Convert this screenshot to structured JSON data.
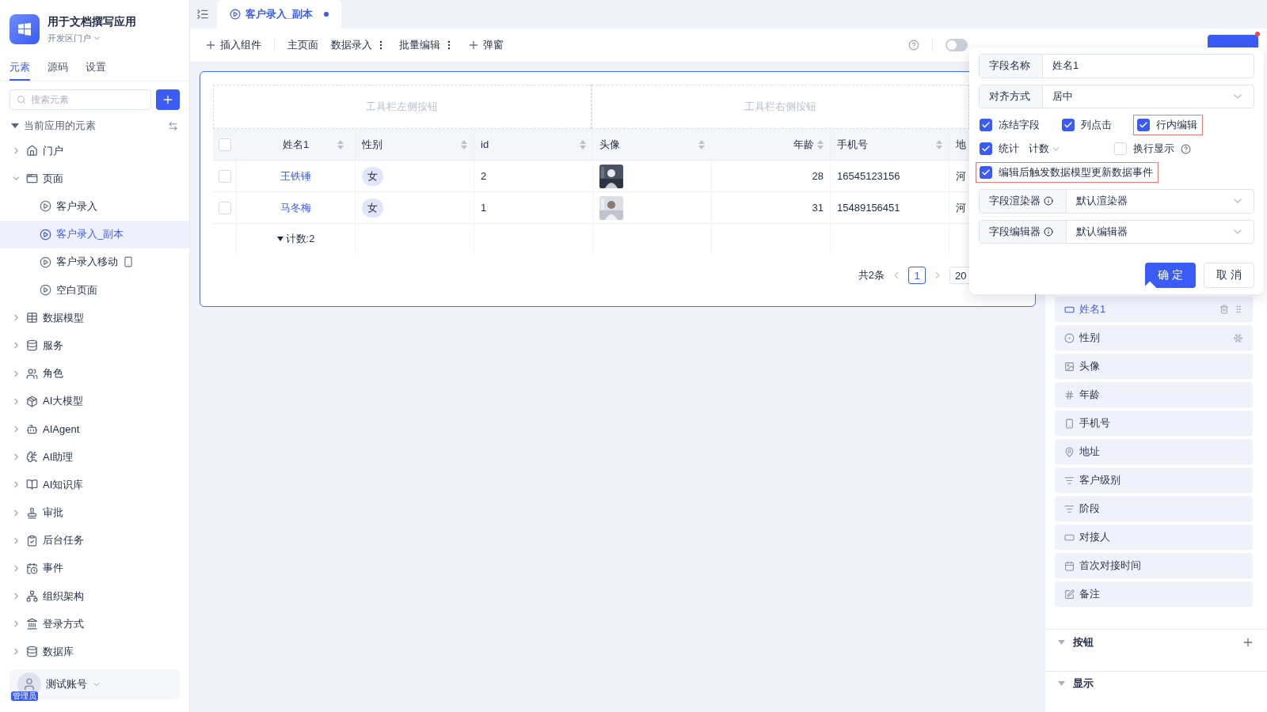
{
  "app": {
    "name": "用于文档撰写应用",
    "portal": "开发区门户"
  },
  "sidebar_tabs": [
    {
      "label": "元素",
      "selected": true
    },
    {
      "label": "源码",
      "selected": false
    },
    {
      "label": "设置",
      "selected": false
    }
  ],
  "search": {
    "placeholder": "搜索元素"
  },
  "tree_header": {
    "label": "当前应用的元素",
    "expanded": true
  },
  "tree": [
    {
      "label": "门户",
      "expanded": false,
      "selected": false
    },
    {
      "label": "页面",
      "expanded": true,
      "selected": false,
      "children": [
        {
          "label": "客户录入",
          "selected": false,
          "mobile": false
        },
        {
          "label": "客户录入_副本",
          "selected": true,
          "mobile": false
        },
        {
          "label": "客户录入移动",
          "selected": false,
          "mobile": true
        },
        {
          "label": "空白页面",
          "selected": false,
          "mobile": false
        }
      ]
    },
    {
      "label": "数据模型",
      "expanded": false,
      "selected": false
    },
    {
      "label": "服务",
      "expanded": false,
      "selected": false
    },
    {
      "label": "角色",
      "expanded": false,
      "selected": false
    },
    {
      "label": "AI大模型",
      "expanded": false,
      "selected": false
    },
    {
      "label": "AIAgent",
      "expanded": false,
      "selected": false
    },
    {
      "label": "AI助理",
      "expanded": false,
      "selected": false
    },
    {
      "label": "AI知识库",
      "expanded": false,
      "selected": false
    },
    {
      "label": "审批",
      "expanded": false,
      "selected": false
    },
    {
      "label": "后台任务",
      "expanded": false,
      "selected": false
    },
    {
      "label": "事件",
      "expanded": false,
      "selected": false
    },
    {
      "label": "组织架构",
      "expanded": false,
      "selected": false
    },
    {
      "label": "登录方式",
      "expanded": false,
      "selected": false
    },
    {
      "label": "数据库",
      "expanded": false,
      "selected": false
    }
  ],
  "user": {
    "name": "测试账号",
    "role": "管理员"
  },
  "tab": {
    "label": "客户录入_副本",
    "modified": true
  },
  "toolbar": [
    {
      "label": "插入组件",
      "kind": "add"
    },
    {
      "label": "主页面",
      "kind": "plain"
    },
    {
      "label": "数据录入",
      "kind": "menu"
    },
    {
      "label": "批量编辑",
      "kind": "menu"
    },
    {
      "label": "弹窗",
      "kind": "add"
    }
  ],
  "ai_toggle": {
    "on": false
  },
  "table": {
    "toolbar_left": "工具栏左侧按钮",
    "toolbar_right": "工具栏右侧按钮",
    "all_checked": false,
    "columns": [
      {
        "label": "姓名1"
      },
      {
        "label": "性别"
      },
      {
        "label": "id"
      },
      {
        "label": "头像"
      },
      {
        "label": "年龄"
      },
      {
        "label": "手机号"
      },
      {
        "label": "地"
      }
    ],
    "rows": [
      {
        "checked": false,
        "cells": [
          "王铁锤",
          "女",
          "2",
          "",
          "28",
          "16545123156",
          "河"
        ]
      },
      {
        "checked": false,
        "cells": [
          "马冬梅",
          "女",
          "1",
          "",
          "31",
          "15489156451",
          "河"
        ]
      }
    ],
    "summary": "计数:2",
    "total": "共2条",
    "page": "1",
    "page_size": "20"
  },
  "popup": {
    "field_name": {
      "label": "字段名称",
      "value": "姓名1"
    },
    "align": {
      "label": "对齐方式",
      "value": "居中"
    },
    "checks": [
      {
        "label": "冻结字段",
        "checked": true,
        "highlighted": false
      },
      {
        "label": "列点击",
        "checked": true,
        "highlighted": false
      },
      {
        "label": "行内编辑",
        "checked": true,
        "highlighted": true
      },
      {
        "label": "统计",
        "checked": true,
        "highlighted": false,
        "select": "计数"
      },
      {
        "label": "换行显示",
        "checked": false,
        "highlighted": false,
        "help": true
      },
      {
        "label": "编辑后触发数据模型更新数据事件",
        "checked": true,
        "highlighted": true
      }
    ],
    "renderer": {
      "label": "字段渲染器",
      "value": "默认渲染器"
    },
    "editor": {
      "label": "字段编辑器",
      "value": "默认编辑器"
    },
    "ok": "确 定",
    "cancel": "取 消"
  },
  "fields": [
    {
      "label": "姓名1",
      "selected": true
    },
    {
      "label": "性别",
      "selected": false,
      "frozen": true
    },
    {
      "label": "头像",
      "selected": false
    },
    {
      "label": "年龄",
      "selected": false
    },
    {
      "label": "手机号",
      "selected": false
    },
    {
      "label": "地址",
      "selected": false
    },
    {
      "label": "客户级别",
      "selected": false
    },
    {
      "label": "阶段",
      "selected": false
    },
    {
      "label": "对接人",
      "selected": false
    },
    {
      "label": "首次对接时间",
      "selected": false
    },
    {
      "label": "备注",
      "selected": false
    }
  ],
  "sections": [
    {
      "title": "按钮",
      "addable": true
    },
    {
      "title": "显示",
      "addable": false
    }
  ]
}
